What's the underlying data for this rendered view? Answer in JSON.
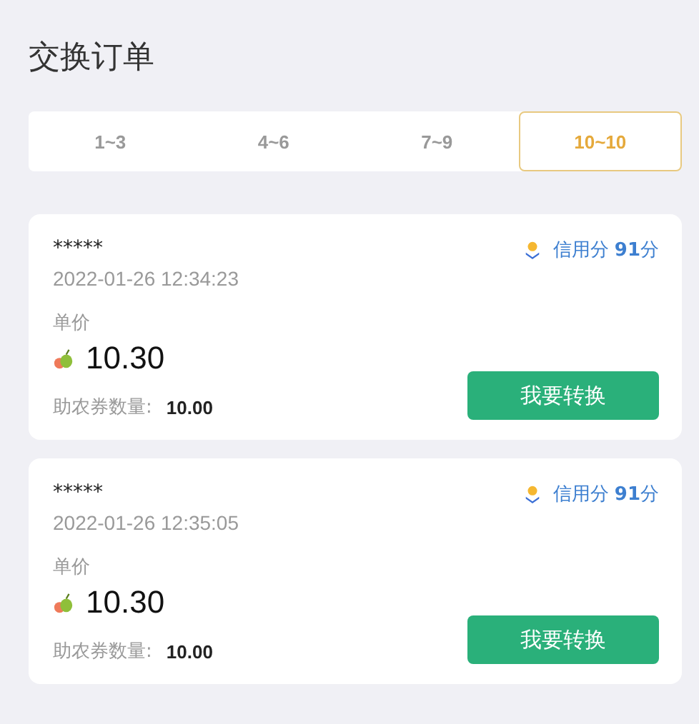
{
  "title": "交换订单",
  "tabs": [
    {
      "label": "1~3",
      "selected": false
    },
    {
      "label": "4~6",
      "selected": false
    },
    {
      "label": "7~9",
      "selected": false
    },
    {
      "label": "10~10",
      "selected": true
    }
  ],
  "orders": [
    {
      "name": "*****",
      "time": "2022-01-26 12:34:23",
      "credit": "信用分 **91**分",
      "price_label": "单价",
      "price": "10.30",
      "quantity_label": "助农券数量:",
      "quantity": "10.00",
      "button": "我要转换"
    },
    {
      "name": "*****",
      "time": "2022-01-26 12:35:05",
      "credit": "信用分 **91**分",
      "price_label": "单价",
      "price": "10.30",
      "quantity_label": "助农券数量:",
      "quantity": "10.00",
      "button": "我要转换"
    }
  ]
}
